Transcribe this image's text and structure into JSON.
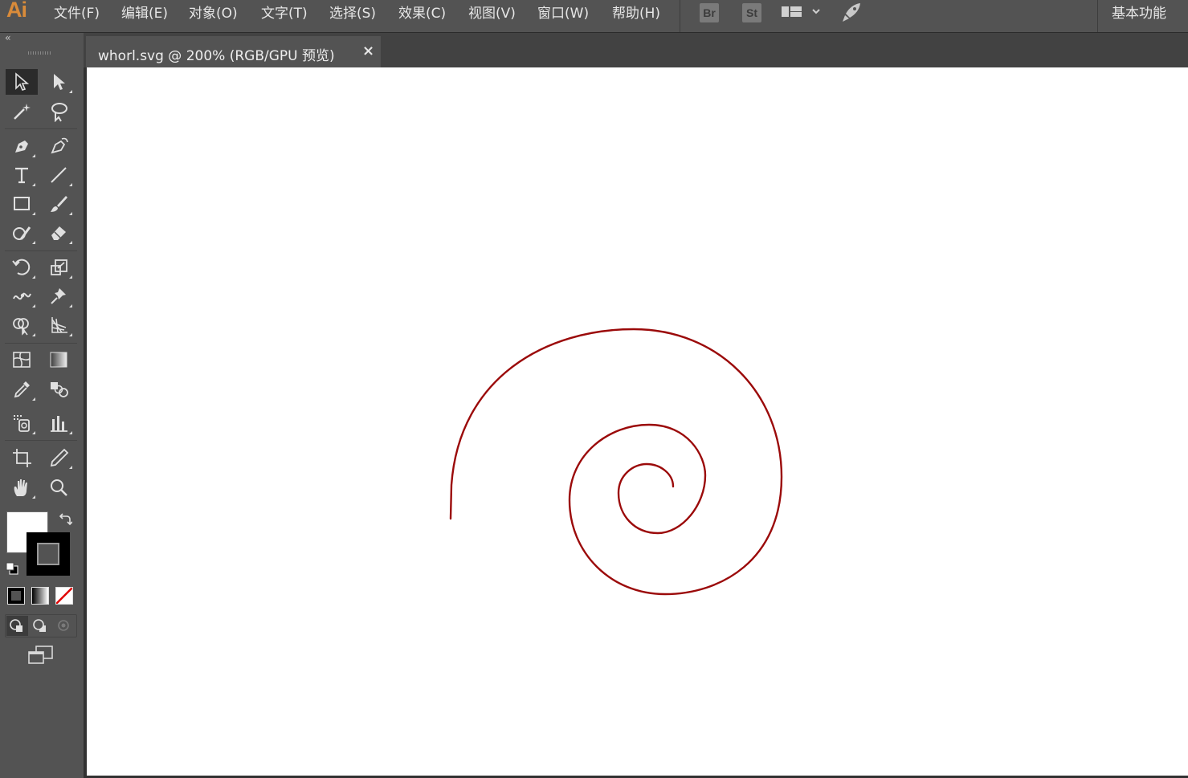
{
  "app": {
    "logo": "Ai"
  },
  "menu": [
    {
      "id": "file",
      "label": "文件(F)"
    },
    {
      "id": "edit",
      "label": "编辑(E)"
    },
    {
      "id": "object",
      "label": "对象(O)"
    },
    {
      "id": "type",
      "label": "文字(T)"
    },
    {
      "id": "select",
      "label": "选择(S)"
    },
    {
      "id": "effect",
      "label": "效果(C)"
    },
    {
      "id": "view",
      "label": "视图(V)"
    },
    {
      "id": "window",
      "label": "窗口(W)"
    },
    {
      "id": "help",
      "label": "帮助(H)"
    }
  ],
  "toolbar": {
    "bridge": "Br",
    "stock": "St",
    "workspace": "基本功能"
  },
  "panel": {
    "collapse": "‹‹"
  },
  "document": {
    "tab_title": "whorl.svg  @  200%  (RGB/GPU 预览)",
    "close_glyph": "×"
  },
  "artwork": {
    "stroke_color": "#9b0a0a",
    "shape": "spiral"
  },
  "colors": {
    "fill": "#ffffff",
    "stroke": "#000000",
    "none_slash": "#e00000"
  }
}
